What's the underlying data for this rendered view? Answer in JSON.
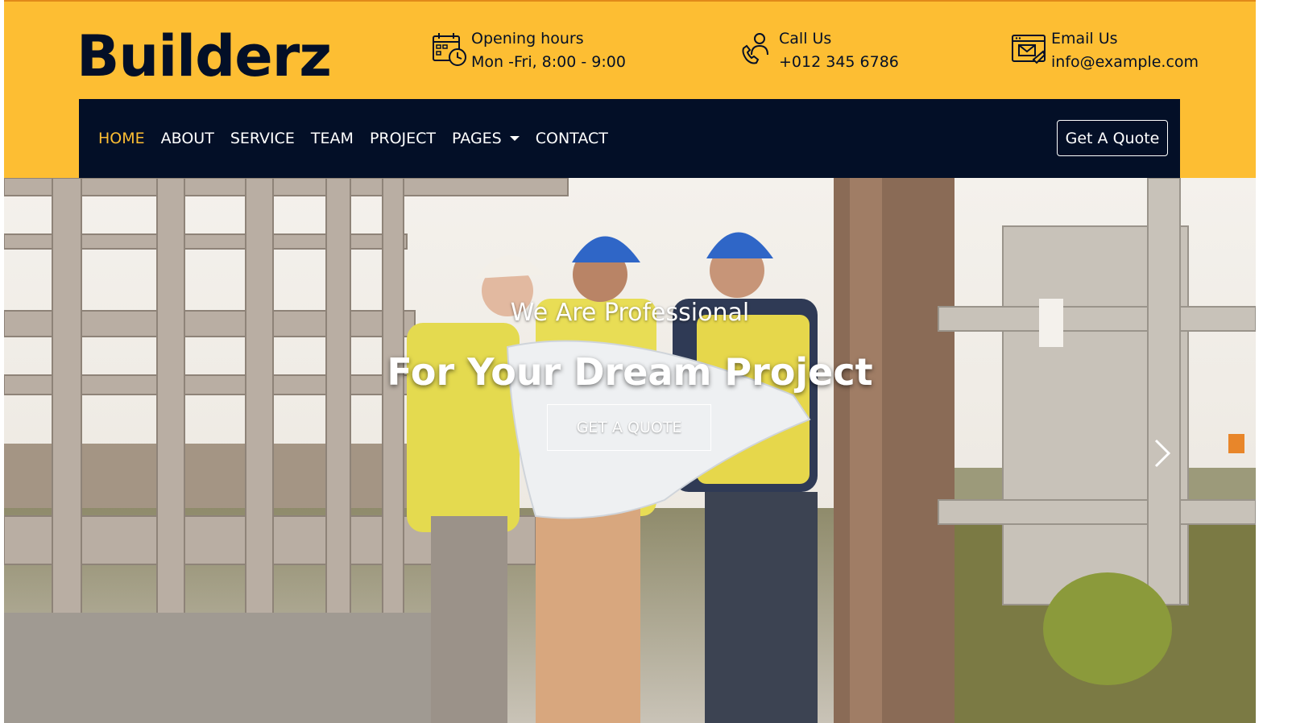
{
  "brand": {
    "logo_text": "Builderz"
  },
  "header_info": [
    {
      "icon": "calendar-clock-icon",
      "title": "Opening hours",
      "value": "Mon -Fri, 8:00 - 9:00"
    },
    {
      "icon": "phone-support-icon",
      "title": "Call Us",
      "value": "+012 345 6786"
    },
    {
      "icon": "email-browser-icon",
      "title": "Email Us",
      "value": "info@example.com"
    }
  ],
  "nav": {
    "items": [
      {
        "label": "HOME",
        "active": true
      },
      {
        "label": "ABOUT"
      },
      {
        "label": "SERVICE"
      },
      {
        "label": "TEAM"
      },
      {
        "label": "PROJECT"
      },
      {
        "label": "PAGES",
        "dropdown": true
      },
      {
        "label": "CONTACT"
      }
    ],
    "cta_label": "Get A Quote"
  },
  "hero": {
    "subtitle": "We Are Professional",
    "title": "For Your Dream Project",
    "button_label": "GET A QUOTE"
  },
  "colors": {
    "accent": "#FDBE33",
    "navy": "#030f27",
    "white": "#ffffff"
  }
}
